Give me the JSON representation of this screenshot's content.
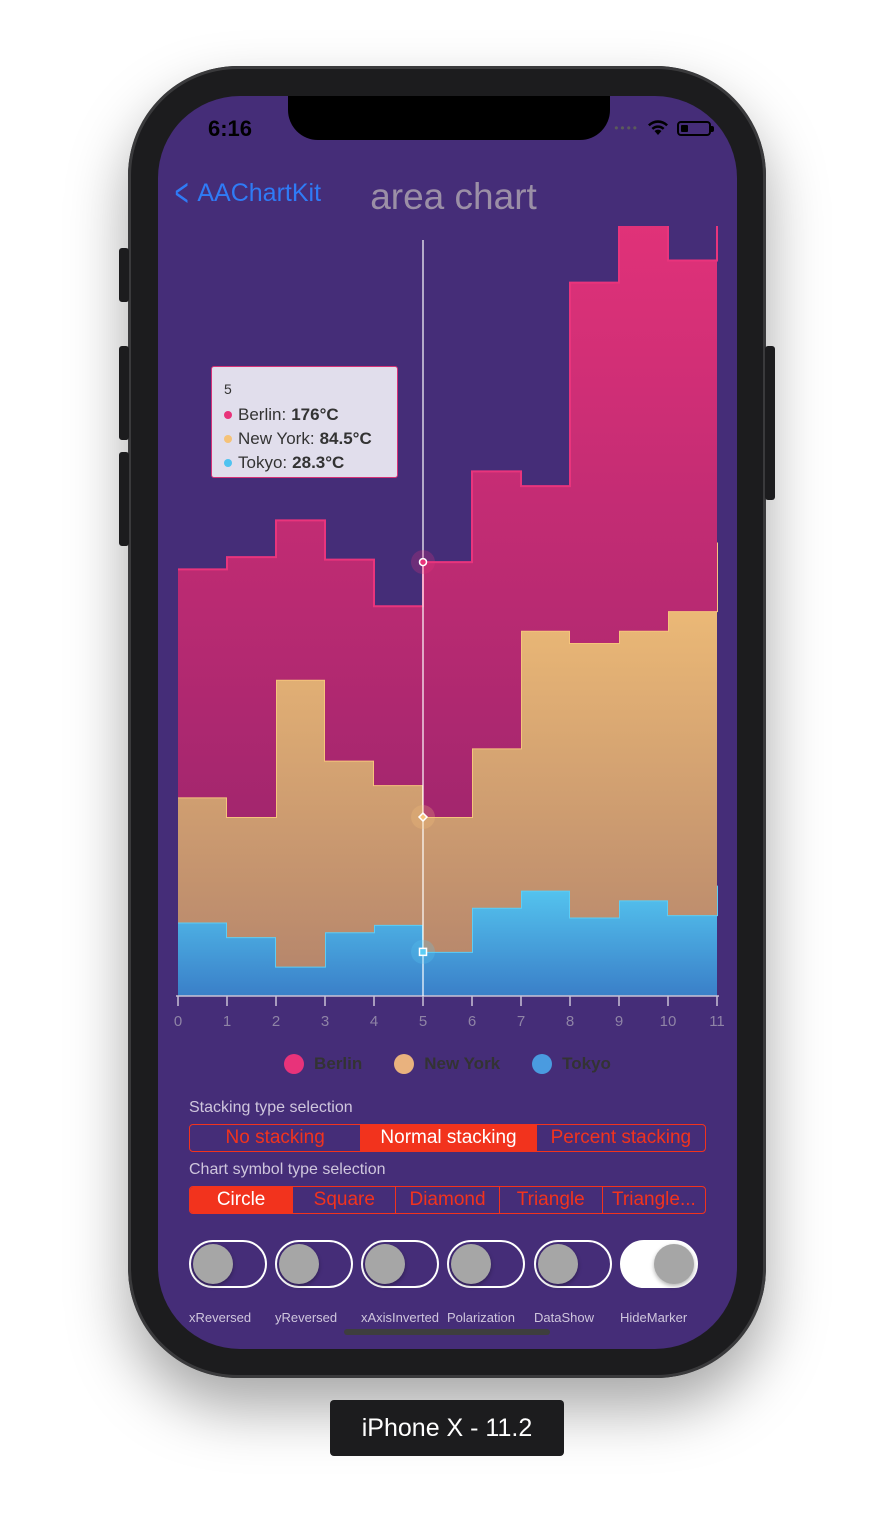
{
  "status_bar": {
    "time": "6:16"
  },
  "nav": {
    "back_label": "AAChartKit",
    "title": "area chart"
  },
  "tooltip": {
    "header": "5",
    "rows": [
      {
        "name": "Berlin",
        "value": "176°C"
      },
      {
        "name": "New York",
        "value": "84.5°C"
      },
      {
        "name": "Tokyo",
        "value": "28.3°C"
      }
    ]
  },
  "chart_data": {
    "type": "area",
    "stacking": "normal",
    "step": true,
    "x": [
      0,
      1,
      2,
      3,
      4,
      5,
      6,
      7,
      8,
      9,
      10,
      11
    ],
    "series": [
      {
        "name": "Tokyo",
        "color": "#4fc3f0",
        "values": [
          30,
          24,
          12,
          26,
          29,
          18,
          36,
          43,
          32,
          39,
          33,
          45
        ]
      },
      {
        "name": "New York",
        "color": "#f5c278",
        "values": [
          51,
          49,
          117,
          70,
          57,
          55,
          65,
          106,
          112,
          110,
          124,
          140
        ]
      },
      {
        "name": "Berlin",
        "color": "#e8337a",
        "values": [
          93,
          106,
          65,
          82,
          73,
          104,
          113,
          59,
          147,
          196,
          143,
          142
        ]
      }
    ],
    "selected_x": 5,
    "ylim": [
      0,
      310
    ],
    "grid": false,
    "legend": "bottom-center"
  },
  "legend": [
    "Berlin",
    "New York",
    "Tokyo"
  ],
  "colors": {
    "berlin": "#e8337a",
    "new_york": "#f5c278",
    "tokyo": "#4fc3f0",
    "accent": "#f2331d",
    "background": "#452d78"
  },
  "stacking": {
    "label": "Stacking type selection",
    "options": [
      "No stacking",
      "Normal stacking",
      "Percent stacking"
    ],
    "selected": "Normal stacking"
  },
  "symbol": {
    "label": "Chart symbol type selection",
    "options": [
      "Circle",
      "Square",
      "Diamond",
      "Triangle",
      "Triangle..."
    ],
    "selected": "Circle"
  },
  "switches": [
    {
      "label": "xReversed",
      "on": false
    },
    {
      "label": "yReversed",
      "on": false
    },
    {
      "label": "xAxisInverted",
      "on": false
    },
    {
      "label": "Polarization",
      "on": false
    },
    {
      "label": "DataShow",
      "on": false
    },
    {
      "label": "HideMarker",
      "on": true
    }
  ],
  "device_label": "iPhone X - 11.2"
}
